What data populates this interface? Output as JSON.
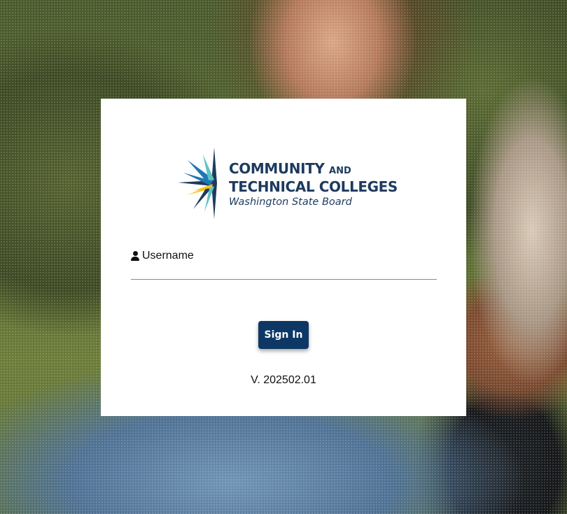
{
  "logo": {
    "line1": "COMMUNITY",
    "line1_small": "AND",
    "line2": "TECHNICAL COLLEGES",
    "line3": "Washington State Board",
    "icon": "star-burst-logo-icon",
    "colors": {
      "navy": "#1e3a5f",
      "blue": "#1f77b4",
      "teal": "#5fc3c4",
      "yellow": "#f2c21b"
    }
  },
  "login": {
    "username_label": "Username",
    "username_icon": "user-icon",
    "username_value": "",
    "signin_label": "Sign In",
    "version": "V. 202502.01"
  },
  "colors": {
    "button": "#0d3765",
    "card": "#ffffff"
  }
}
